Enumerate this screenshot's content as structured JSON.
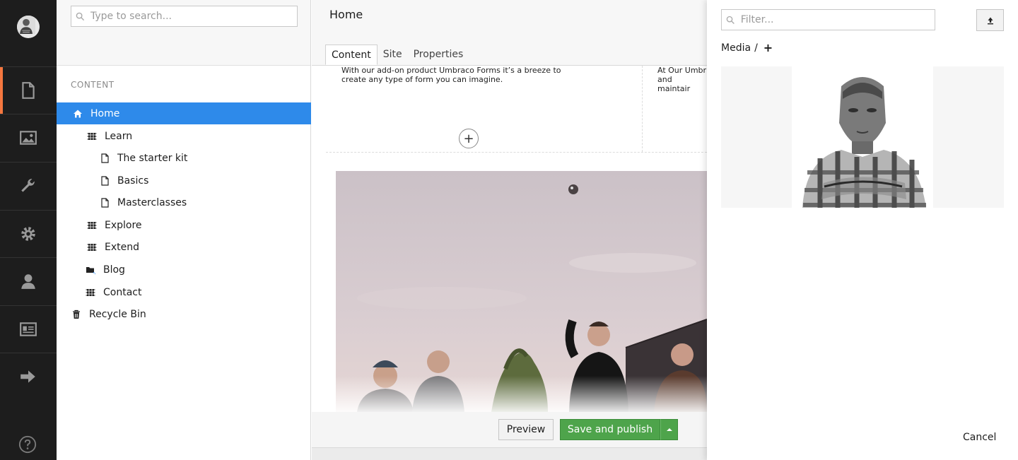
{
  "tree": {
    "search_placeholder": "Type to search...",
    "title": "CONTENT",
    "nodes": [
      {
        "label": "Home"
      },
      {
        "label": "Learn"
      },
      {
        "label": "The starter kit"
      },
      {
        "label": "Basics"
      },
      {
        "label": "Masterclasses"
      },
      {
        "label": "Explore"
      },
      {
        "label": "Extend"
      },
      {
        "label": "Blog"
      },
      {
        "label": "Contact"
      },
      {
        "label": "Recycle Bin"
      }
    ]
  },
  "editor": {
    "page_name": "Home",
    "tabs": [
      {
        "label": "Content",
        "active": true
      },
      {
        "label": "Site",
        "active": false
      },
      {
        "label": "Properties",
        "active": false
      }
    ],
    "col1_line1": "With our add-on product Umbraco Forms it’s a breeze to",
    "col1_line2": "create any type of form you can imagine.",
    "col2_line1": "At Our Umbr",
    "col2_line2": "and maintair",
    "add_symbol": "+",
    "preview_label": "Preview",
    "publish_label": "Save and publish"
  },
  "picker": {
    "filter_placeholder": "Filter...",
    "breadcrumb_root": "Media",
    "breadcrumb_sep": "/",
    "breadcrumb_add": "+",
    "cancel_label": "Cancel"
  },
  "colors": {
    "rail": "#1d1d1d",
    "rail_active_accent": "#f5773f",
    "selected_node": "#2e8aea",
    "publish_green": "#4ea44b"
  },
  "icons": {
    "rail": [
      "content-icon",
      "media-icon",
      "settings-wrench-icon",
      "developer-gear-icon",
      "users-icon",
      "members-icon",
      "forms-arrow-icon",
      "help-icon"
    ],
    "tree": [
      "home-icon",
      "grid-icon",
      "document-icon",
      "folder-icon",
      "trash-icon"
    ]
  }
}
